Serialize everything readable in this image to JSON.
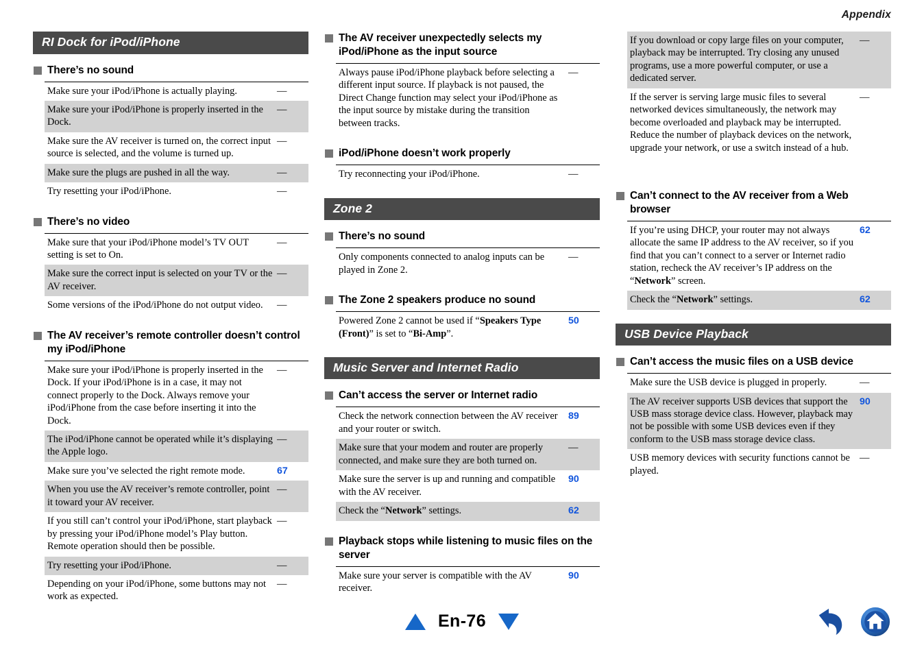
{
  "header": {
    "running_title": "Appendix"
  },
  "footer": {
    "page_label": "En-76",
    "prev_icon": "triangle-up-icon",
    "next_icon": "triangle-down-icon",
    "back_icon": "back-arrow-icon",
    "home_icon": "home-icon",
    "accent_color": "#1667c8"
  },
  "colors": {
    "section_bar_bg": "#4a4a4a",
    "row_shade": "#d2d2d2",
    "page_ref_blue": "#1155dd",
    "bullet_gray": "#767676"
  },
  "column1": {
    "section_title": "RI Dock for iPod/iPhone",
    "blocks": [
      {
        "subhead": "There’s no sound",
        "rows": [
          {
            "text": "Make sure your iPod/iPhone is actually playing.",
            "ref": "—",
            "shade": false
          },
          {
            "text": "Make sure your iPod/iPhone is properly inserted in the Dock.",
            "ref": "—",
            "shade": true
          },
          {
            "text": "Make sure the AV receiver is turned on, the correct input source is selected, and the volume is turned up.",
            "ref": "—",
            "shade": false
          },
          {
            "text": "Make sure the plugs are pushed in all the way.",
            "ref": "—",
            "shade": true
          },
          {
            "text": "Try resetting your iPod/iPhone.",
            "ref": "—",
            "shade": false
          }
        ]
      },
      {
        "subhead": "There’s no video",
        "rows": [
          {
            "text": "Make sure that your iPod/iPhone model’s TV OUT setting is set to On.",
            "ref": "—",
            "shade": false
          },
          {
            "text": "Make sure the correct input is selected on your TV or the AV receiver.",
            "ref": "—",
            "shade": true
          },
          {
            "text": "Some versions of the iPod/iPhone do not output video.",
            "ref": "—",
            "shade": false
          }
        ]
      },
      {
        "subhead": "The AV receiver’s remote controller doesn’t control my iPod/iPhone",
        "rows": [
          {
            "text": "Make sure your iPod/iPhone is properly inserted in the Dock. If your iPod/iPhone is in a case, it may not connect properly to the Dock. Always remove your iPod/iPhone from the case before inserting it into the Dock.",
            "ref": "—",
            "shade": false
          },
          {
            "text": "The iPod/iPhone cannot be operated while it’s displaying the Apple logo.",
            "ref": "—",
            "shade": true
          },
          {
            "text": "Make sure you’ve selected the right remote mode.",
            "ref": "67",
            "shade": false
          },
          {
            "text": "When you use the AV receiver’s remote controller, point it toward your AV receiver.",
            "ref": "—",
            "shade": true
          },
          {
            "text": "If you still can’t control your iPod/iPhone, start playback by pressing your iPod/iPhone model’s Play button. Remote operation should then be possible.",
            "ref": "—",
            "shade": false
          },
          {
            "text": "Try resetting your iPod/iPhone.",
            "ref": "—",
            "shade": true
          },
          {
            "text": "Depending on your iPod/iPhone, some buttons may not work as expected.",
            "ref": "—",
            "shade": false
          }
        ]
      }
    ]
  },
  "column2": {
    "top_blocks": [
      {
        "subhead": "The AV receiver unexpectedly selects my iPod/iPhone as the input source",
        "rows": [
          {
            "text": "Always pause iPod/iPhone playback before selecting a different input source. If playback is not paused, the Direct Change function may select your iPod/iPhone as the input source by mistake during the transition between tracks.",
            "ref": "—",
            "shade": false
          }
        ]
      },
      {
        "subhead": "iPod/iPhone doesn’t work properly",
        "rows": [
          {
            "text": "Try reconnecting your iPod/iPhone.",
            "ref": "—",
            "shade": false
          }
        ]
      }
    ],
    "section_zone2_title": "Zone 2",
    "zone2_blocks": [
      {
        "subhead": "There’s no sound",
        "rows": [
          {
            "text": "Only components connected to analog inputs can be played in Zone 2.",
            "ref": "—",
            "shade": false
          }
        ]
      },
      {
        "subhead": "The Zone 2 speakers produce no sound",
        "rows": [
          {
            "html": "Powered Zone 2 cannot be used if “<b>Speakers Type (Front)</b>” is set to “<b>Bi-Amp</b>”.",
            "ref": "50",
            "shade": false
          }
        ]
      }
    ],
    "section_music_title": "Music Server and Internet Radio",
    "music_blocks": [
      {
        "subhead": "Can’t access the server or Internet radio",
        "rows": [
          {
            "text": "Check the network connection between the AV receiver and your router or switch.",
            "ref": "89",
            "shade": false
          },
          {
            "text": "Make sure that your modem and router are properly connected, and make sure they are both turned on.",
            "ref": "—",
            "shade": true
          },
          {
            "text": "Make sure the server is up and running and compatible with the AV receiver.",
            "ref": "90",
            "shade": false
          },
          {
            "html": "Check the “<b>Network</b>” settings.",
            "ref": "62",
            "shade": true
          }
        ]
      },
      {
        "subhead": "Playback stops while listening to music files on the server",
        "rows": [
          {
            "text": "Make sure your server is compatible with the AV receiver.",
            "ref": "90",
            "shade": false
          }
        ]
      }
    ]
  },
  "column3": {
    "continued_rows": [
      {
        "text": "If you download or copy large files on your computer, playback may be interrupted. Try closing any unused programs, use a more powerful computer, or use a dedicated server.",
        "ref": "—",
        "shade": true
      },
      {
        "text": "If the server is serving large music files to several networked devices simultaneously, the network may become overloaded and playback may be interrupted. Reduce the number of playback devices on the network, upgrade your network, or use a switch instead of a hub.",
        "ref": "—",
        "shade": false
      }
    ],
    "web_block": {
      "subhead": "Can’t connect to the AV receiver from a Web browser",
      "rows": [
        {
          "html": "If you’re using DHCP, your router may not always allocate the same IP address to the AV receiver, so if you find that you can’t connect to a server or Internet radio station, recheck the AV receiver’s IP address on the “<b>Network</b>” screen.",
          "ref": "62",
          "shade": false
        },
        {
          "html": "Check the “<b>Network</b>” settings.",
          "ref": "62",
          "shade": true
        }
      ]
    },
    "section_usb_title": "USB Device Playback",
    "usb_block": {
      "subhead": "Can’t access the music files on a USB device",
      "rows": [
        {
          "text": "Make sure the USB device is plugged in properly.",
          "ref": "—",
          "shade": false
        },
        {
          "text": "The AV receiver supports USB devices that support the USB mass storage device class. However, playback may not be possible with some USB devices even if they conform to the USB mass storage device class.",
          "ref": "90",
          "shade": true
        },
        {
          "text": "USB memory devices with security functions cannot be played.",
          "ref": "—",
          "shade": false
        }
      ]
    }
  }
}
